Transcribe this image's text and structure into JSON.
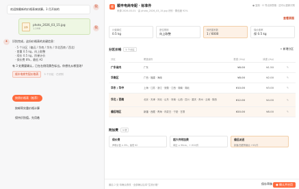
{
  "chat": {
    "greeting": "欢迎按最新的价格表来核算。3 月开始的",
    "file": {
      "name": "photo_2026_03_15.jpg",
      "size": "1.2MB",
      "type": "文件"
    },
    "analysis_intro": "识别完成，这份价格表的关键信息：",
    "bullets": [
      "· 5 个分区（偏远 / 华南 / 华东 / 华北西南 / 西北）",
      "· 首重 0.5 kg，向上取整",
      "· 续价 0.5 kg，阶梯计价",
      "· 保价费 8%，最低 ¥2"
    ],
    "followup": "有 3 处需要确认，已在右侧用黄色标出。你想先从哪里改？",
    "tag": "顺丰电商专配价格表",
    "tag_sub": "5 个分区 · 已识别",
    "options": [
      "按原价格表（推荐）",
      "按邮寄实重价格计算",
      "保持识别值，先用着"
    ]
  },
  "header": {
    "logo": "顺",
    "title": "顺丰电商专配 · 标准件",
    "subtitle": "来源 2026-03-01 · 由 photo_2026_03_15.jpg 识别 · 置信度 92%",
    "links": "● 复制 · ⊡ 导出到表格 · 还可以重新识别",
    "action": "查看原图"
  },
  "stats": [
    {
      "k": "计费单位",
      "v": "0.5 kg"
    },
    {
      "k": "进位规则",
      "v": "向上取整"
    },
    {
      "k": "体积重系数",
      "v": "1 / 6000"
    },
    {
      "k": "保价费率",
      "v": "保 0.5 kg"
    }
  ],
  "zones": {
    "title": "分区价格",
    "pill": "5 个分区",
    "add": "+ 新增分区",
    "headers": [
      "分区",
      "覆盖省份",
      "首重 (1kg)",
      "续重 (/kg)",
      ""
    ],
    "rows": [
      {
        "name": "广东省内",
        "provinces": "广东",
        "first": "¥6.00",
        "cont": "¥1.50",
        "edit": "✎"
      },
      {
        "name": "华南区",
        "provinces": "广西 · 福建 · 海南",
        "first": "¥8.00",
        "cont": "¥2.00",
        "edit": "✎"
      },
      {
        "name": "华东 / 华中",
        "provinces": "上海 · 江苏 · 浙江 · 安徽 · 江西 · 湖南 · 湖北",
        "first": "¥10.00",
        "cont": "¥3.00",
        "edit": "✎"
      },
      {
        "name": "华北 / 西南",
        "provinces": "北京 · 天津 · 河北 · 山东 · 河南 · 山西 · 四川 · 重庆 · 贵州 · 云南 · 陕西",
        "first": "¥12.00",
        "cont": "¥4.00",
        "edit": "✎"
      },
      {
        "name": "偏远地区",
        "provinces": "新疆 · 西藏 · 青海 · 内蒙古 · 宁夏 · 甘肃",
        "first": "¥20.00",
        "cont": "¥8.00",
        "edit": "✎"
      }
    ]
  },
  "extras": {
    "title": "附加费",
    "pill": "3 项",
    "cards": [
      {
        "t": "保价费",
        "d": "声明价值 × 8%，最低 ¥2"
      },
      {
        "t": "超大件附加费",
        "d": "单边 ≥ 90cm，+ ¥10/件"
      },
      {
        "t": "偏远派送",
        "d": "新疆/西藏等偏远 +¥5/件"
      }
    ]
  },
  "footer": {
    "note": "最后 2 处 待确认修改 · 全部确认后将\"生效价格\"",
    "btn1": "保存草稿",
    "btn2": "● 确认并启用"
  }
}
